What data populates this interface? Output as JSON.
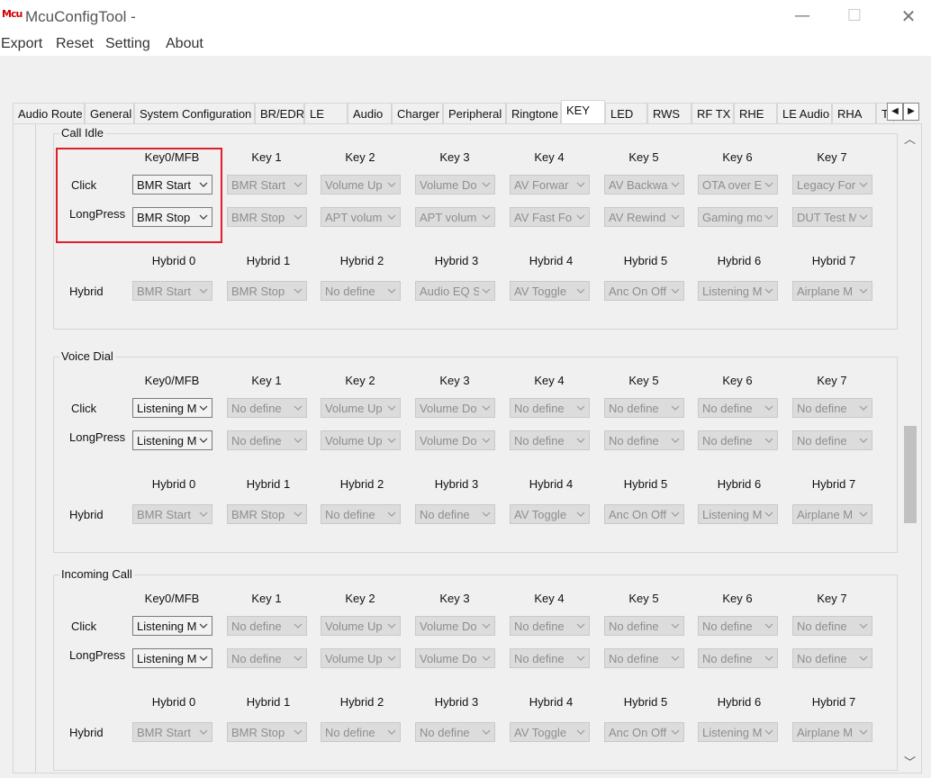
{
  "window": {
    "title": "McuConfigTool -",
    "logo_text": "Mcu",
    "controls": {
      "minimize": "—",
      "maximize": "☐",
      "close": "✕"
    }
  },
  "menu": [
    "Export",
    "Reset",
    "Setting",
    "About"
  ],
  "tabs": [
    "Audio Route",
    "General",
    "System Configuration",
    "BR/EDR",
    "LE",
    "Audio",
    "Charger",
    "Peripheral",
    "Ringtone",
    "KEY",
    "LED",
    "RWS",
    "RF TX",
    "RHE",
    "LE Audio",
    "RHA",
    "T"
  ],
  "active_tab": "KEY",
  "row_labels": {
    "click": "Click",
    "longpress": "LongPress",
    "hybrid": "Hybrid"
  },
  "key_headers": [
    "Key0/MFB",
    "Key 1",
    "Key 2",
    "Key 3",
    "Key 4",
    "Key 5",
    "Key 6",
    "Key 7"
  ],
  "hybrid_headers": [
    "Hybrid 0",
    "Hybrid 1",
    "Hybrid 2",
    "Hybrid 3",
    "Hybrid 4",
    "Hybrid 5",
    "Hybrid 6",
    "Hybrid 7"
  ],
  "colors": {
    "highlight": "#e01e2a",
    "window_bg": "#f0f0f0"
  },
  "groups": [
    {
      "title": "Call Idle",
      "click": [
        "BMR Start",
        "BMR Start",
        "Volume Up",
        "Volume Do",
        "AV Forwar",
        "AV Backwa",
        "OTA over E",
        "Legacy For"
      ],
      "longpress": [
        "BMR Stop",
        "BMR Stop",
        "APT volum",
        "APT volum",
        "AV Fast Fo",
        "AV Rewind",
        "Gaming mo",
        "DUT Test M"
      ],
      "hybrid": [
        "BMR Start",
        "BMR Stop",
        "No define",
        "Audio EQ S",
        "AV Toggle",
        "Anc On Off",
        "Listening M",
        "Airplane M"
      ]
    },
    {
      "title": "Voice Dial",
      "click": [
        "Listening M",
        "No define",
        "Volume Up",
        "Volume Do",
        "No define",
        "No define",
        "No define",
        "No define"
      ],
      "longpress": [
        "Listening M",
        "No define",
        "Volume Up",
        "Volume Do",
        "No define",
        "No define",
        "No define",
        "No define"
      ],
      "hybrid": [
        "BMR Start",
        "BMR Stop",
        "No define",
        "No define",
        "AV Toggle",
        "Anc On Off",
        "Listening M",
        "Airplane M"
      ]
    },
    {
      "title": "Incoming Call",
      "click": [
        "Listening M",
        "No define",
        "Volume Up",
        "Volume Do",
        "No define",
        "No define",
        "No define",
        "No define"
      ],
      "longpress": [
        "Listening M",
        "No define",
        "Volume Up",
        "Volume Do",
        "No define",
        "No define",
        "No define",
        "No define"
      ],
      "hybrid": [
        "BMR Start",
        "BMR Stop",
        "No define",
        "No define",
        "AV Toggle",
        "Anc On Off",
        "Listening M",
        "Airplane M"
      ]
    }
  ]
}
